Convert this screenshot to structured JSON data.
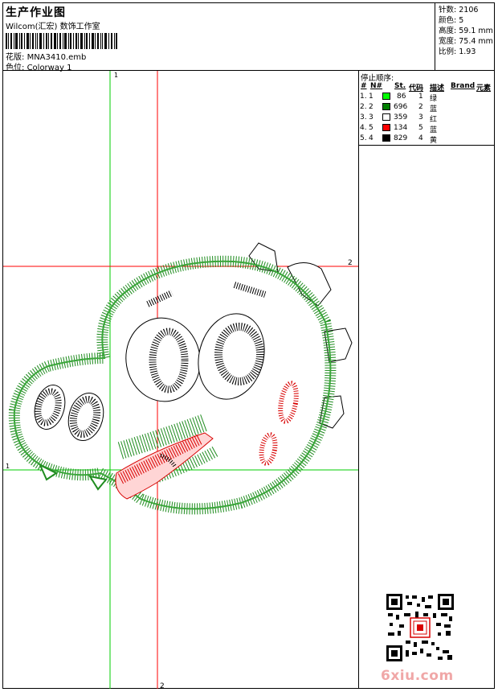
{
  "header": {
    "title": "生产作业图",
    "studio": "Wilcom(汇宏) 数饰工作室",
    "design_label": "花版:",
    "design_value": "MNA3410.emb",
    "colorway_label": "色位:",
    "colorway_value": "Colorway 1"
  },
  "stats": [
    {
      "label": "针数:",
      "value": "2106"
    },
    {
      "label": "颜色:",
      "value": "5"
    },
    {
      "label": "高度:",
      "value": "59.1 mm"
    },
    {
      "label": "宽度:",
      "value": "75.4 mm"
    },
    {
      "label": "比例:",
      "value": "1.93"
    }
  ],
  "stop_sequence": {
    "title": "停止顺序:",
    "headers": [
      "#",
      "N#",
      "St.",
      "代码",
      "描述",
      "Brand",
      "元素"
    ],
    "rows": [
      {
        "num": "1.",
        "n": "1",
        "color": "#00ff00",
        "stitches": "86",
        "code": "1",
        "desc": "绿"
      },
      {
        "num": "2.",
        "n": "2",
        "color": "#008000",
        "stitches": "696",
        "code": "2",
        "desc": "蓝"
      },
      {
        "num": "3.",
        "n": "3",
        "color": "#ffffff",
        "stitches": "359",
        "code": "3",
        "desc": "红"
      },
      {
        "num": "4.",
        "n": "5",
        "color": "#ff0000",
        "stitches": "134",
        "code": "5",
        "desc": "蓝"
      },
      {
        "num": "5.",
        "n": "4",
        "color": "#000000",
        "stitches": "829",
        "code": "4",
        "desc": "黄"
      }
    ]
  },
  "guides": {
    "green_v": "1",
    "green_h": "1",
    "red_v": "2",
    "red_h": "2"
  },
  "colors": {
    "guide_green": "#00cc00",
    "guide_red": "#ff0000",
    "outline_green": "#1f8c1f",
    "stitch_red": "#d80000",
    "brand_pink": "#f0a7a7"
  },
  "watermark": "6xiu.com"
}
